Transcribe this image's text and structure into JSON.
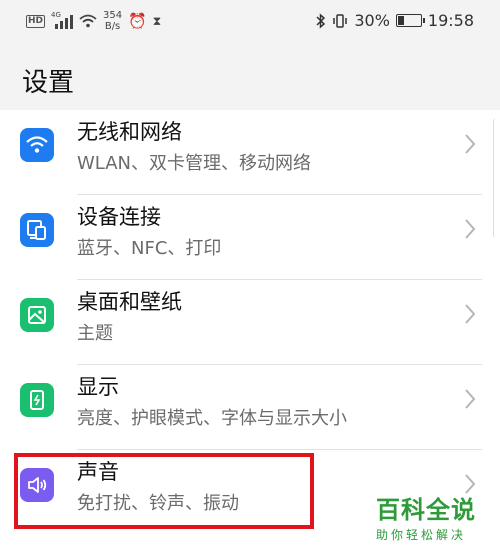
{
  "status_bar": {
    "hd": "HD",
    "network": "4G",
    "speed_value": "354",
    "speed_unit": "B/s",
    "battery": "30%",
    "battery_level": 0.3,
    "time": "19:58"
  },
  "header": {
    "title": "设置"
  },
  "items": [
    {
      "title": "无线和网络",
      "subtitle": "WLAN、双卡管理、移动网络",
      "icon": "wifi-icon",
      "color": "#1e7bf0"
    },
    {
      "title": "设备连接",
      "subtitle": "蓝牙、NFC、打印",
      "icon": "device-connection-icon",
      "color": "#1e7bf0"
    },
    {
      "title": "桌面和壁纸",
      "subtitle": "主题",
      "icon": "wallpaper-icon",
      "color": "#1bbf70"
    },
    {
      "title": "显示",
      "subtitle": "亮度、护眼模式、字体与显示大小",
      "icon": "display-icon",
      "color": "#1bbf70"
    },
    {
      "title": "声音",
      "subtitle": "免打扰、铃声、振动",
      "icon": "sound-icon",
      "color": "#7b5cf0"
    }
  ],
  "highlight_color": "#e0141b",
  "watermark": {
    "title": "百科全说",
    "subtitle": "助你轻松解决"
  }
}
